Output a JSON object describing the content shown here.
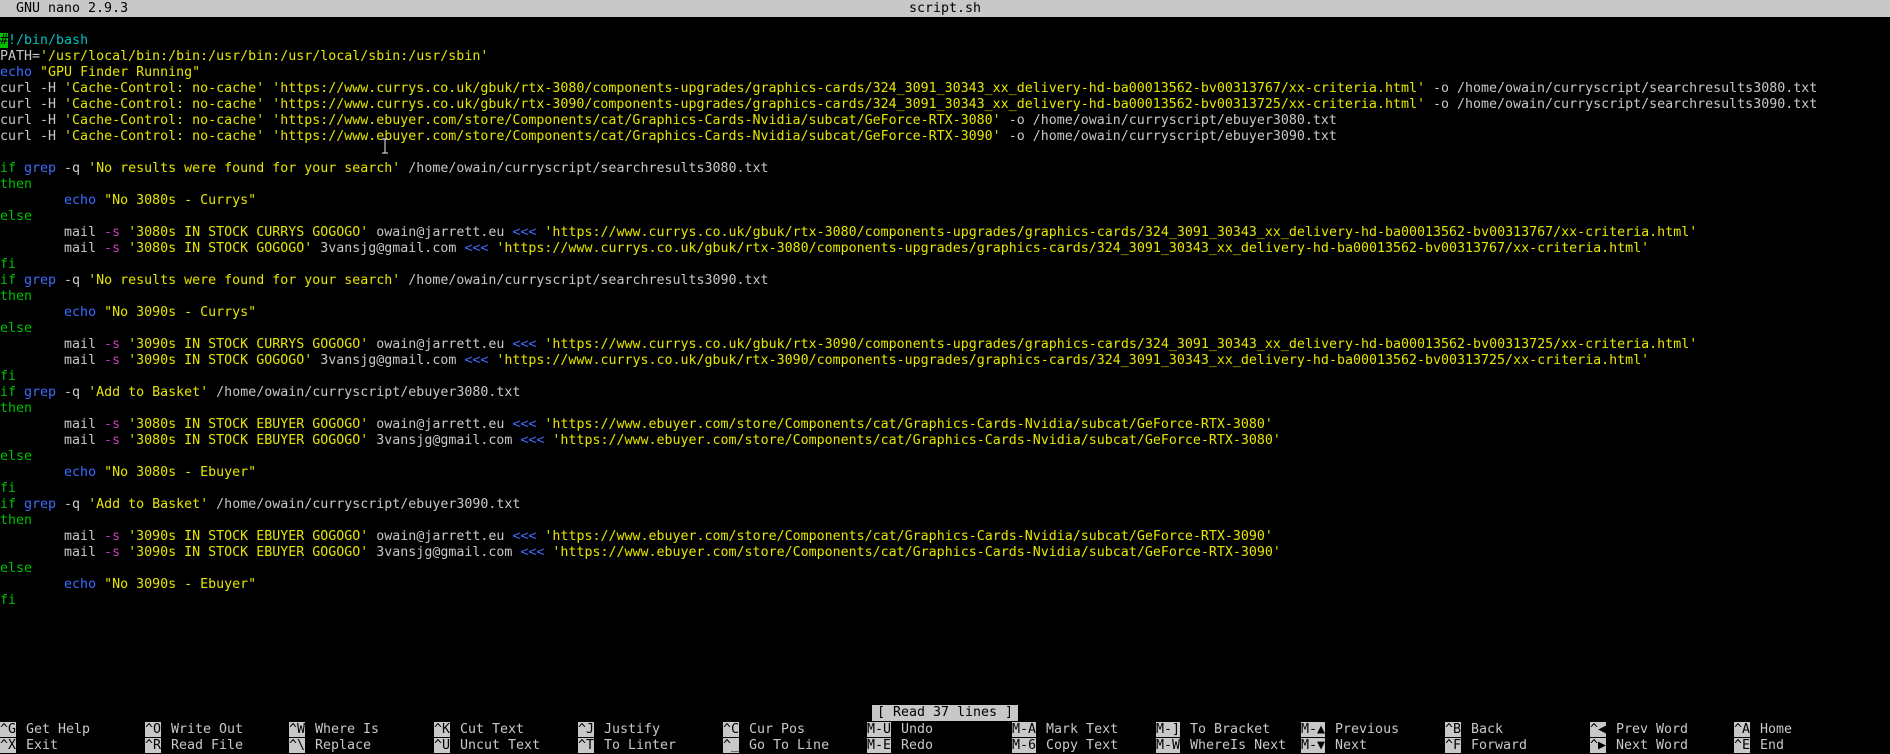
{
  "title": {
    "app": "GNU nano 2.9.3",
    "filename": "script.sh"
  },
  "editor": {
    "l01_shebang_c": "#",
    "l01_shebang_r": "!/bin/bash",
    "l02_path_var": "PATH=",
    "l02_path_val": "'/usr/local/bin:/bin:/usr/bin:/usr/local/sbin:/usr/sbin'",
    "l03_echo": "echo",
    "l03_str": " \"GPU Finder Running\"",
    "l04_cmd": "curl -H ",
    "l04_str": "'Cache-Control: no-cache' 'https://www.currys.co.uk/gbuk/rtx-3080/components-upgrades/graphics-cards/324_3091_30343_xx_delivery-hd-ba00013562-bv00313767/xx-criteria.html'",
    "l04_tail": " -o /home/owain/curryscript/searchresults3080.txt",
    "l05_cmd": "curl -H ",
    "l05_str": "'Cache-Control: no-cache' 'https://www.currys.co.uk/gbuk/rtx-3090/components-upgrades/graphics-cards/324_3091_30343_xx_delivery-hd-ba00013562-bv00313725/xx-criteria.html'",
    "l05_tail": " -o /home/owain/curryscript/searchresults3090.txt",
    "l06_cmd": "curl -H ",
    "l06_str": "'Cache-Control: no-cache' 'https://www.ebuyer.com/store/Components/cat/Graphics-Cards-Nvidia/subcat/GeForce-RTX-3080'",
    "l06_tail": " -o /home/owain/curryscript/ebuyer3080.txt",
    "l07_cmd": "curl -H ",
    "l07_str": "'Cache-Control: no-cache' 'https://www.ebuyer.com/store/Components/cat/Graphics-Cards-Nvidia/subcat/GeForce-RTX-3090'",
    "l07_tail": " -o /home/owain/curryscript/ebuyer3090.txt",
    "kw_if": "if",
    "kw_grep": " grep",
    "opt_q": " -q ",
    "kw_then": "then",
    "kw_else": "else",
    "kw_fi": "fi",
    "indent": "        ",
    "l09_str": "'No results were found for your search'",
    "l09_tail": " /home/owain/curryscript/searchresults3080.txt",
    "l11_str": " \"No 3080s - Currys\"",
    "mail": "mail ",
    "opt_s": "-s ",
    "heredoc": "<<<",
    "l13_subj": "'3080s IN STOCK CURRYS GOGOGO'",
    "addr1": " owain@jarrett.eu ",
    "addr2": " 3vansjg@gmail.com ",
    "l13_url": " 'https://www.currys.co.uk/gbuk/rtx-3080/components-upgrades/graphics-cards/324_3091_30343_xx_delivery-hd-ba00013562-bv00313767/xx-criteria.html'",
    "l14_subj": "'3080s IN STOCK GOGOGO'",
    "l16_str": "'No results were found for your search'",
    "l16_tail": " /home/owain/curryscript/searchresults3090.txt",
    "l18_str": " \"No 3090s - Currys\"",
    "l20_subj": "'3090s IN STOCK CURRYS GOGOGO'",
    "l20_url": " 'https://www.currys.co.uk/gbuk/rtx-3090/components-upgrades/graphics-cards/324_3091_30343_xx_delivery-hd-ba00013562-bv00313725/xx-criteria.html'",
    "l21_subj": "'3090s IN STOCK GOGOGO'",
    "l23_str": "'Add to Basket'",
    "l23_tail": " /home/owain/curryscript/ebuyer3080.txt",
    "l25_subj": "'3080s IN STOCK EBUYER GOGOGO'",
    "l25_url": " 'https://www.ebuyer.com/store/Components/cat/Graphics-Cards-Nvidia/subcat/GeForce-RTX-3080'",
    "l28_str": " \"No 3080s - Ebuyer\"",
    "l30_tail": " /home/owain/curryscript/ebuyer3090.txt",
    "l32_subj": "'3090s IN STOCK EBUYER GOGOGO'",
    "l32_url": " 'https://www.ebuyer.com/store/Components/cat/Graphics-Cards-Nvidia/subcat/GeForce-RTX-3090'",
    "l35_str": " \"No 3090s - Ebuyer\""
  },
  "status_message": "[ Read 37 lines ]",
  "shortcuts": [
    {
      "key": "^G",
      "label": "Get Help"
    },
    {
      "key": "^X",
      "label": "Exit"
    },
    {
      "key": "^O",
      "label": "Write Out"
    },
    {
      "key": "^R",
      "label": "Read File"
    },
    {
      "key": "^W",
      "label": "Where Is"
    },
    {
      "key": "^\\",
      "label": "Replace"
    },
    {
      "key": "^K",
      "label": "Cut Text"
    },
    {
      "key": "^U",
      "label": "Uncut Text"
    },
    {
      "key": "^J",
      "label": "Justify"
    },
    {
      "key": "^T",
      "label": "To Linter"
    },
    {
      "key": "^C",
      "label": "Cur Pos"
    },
    {
      "key": "^_",
      "label": "Go To Line"
    },
    {
      "key": "M-U",
      "label": "Undo"
    },
    {
      "key": "M-E",
      "label": "Redo"
    },
    {
      "key": "M-A",
      "label": "Mark Text"
    },
    {
      "key": "M-6",
      "label": "Copy Text"
    },
    {
      "key": "M-]",
      "label": "To Bracket"
    },
    {
      "key": "M-W",
      "label": "WhereIs Next"
    },
    {
      "key": "M-▲",
      "label": "Previous"
    },
    {
      "key": "M-▼",
      "label": "Next"
    },
    {
      "key": "^B",
      "label": "Back"
    },
    {
      "key": "^F",
      "label": "Forward"
    },
    {
      "key": "^◀",
      "label": "Prev Word"
    },
    {
      "key": "^▶",
      "label": "Next Word"
    },
    {
      "key": "^A",
      "label": "Home"
    },
    {
      "key": "^E",
      "label": "End"
    }
  ],
  "colors": {
    "background": "#000000",
    "text": "#c8c8c8",
    "keyword": "#00c000",
    "command": "#3b6cff",
    "string": "#e6e600",
    "option": "#c040c0",
    "bash_path": "#00c0c0",
    "bar": "#c8c8c8"
  }
}
